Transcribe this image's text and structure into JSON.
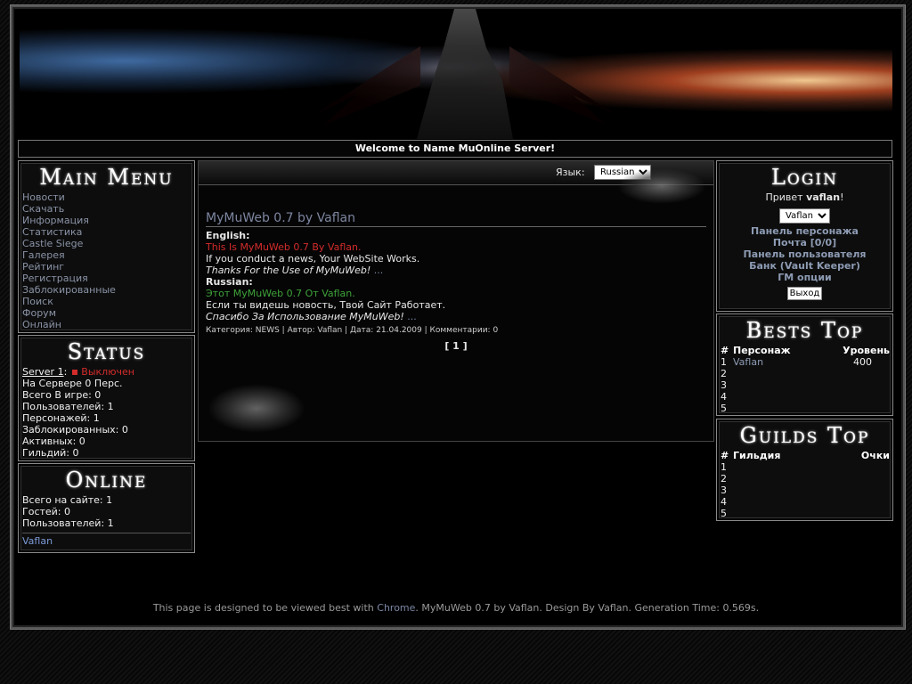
{
  "header": {
    "welcome": "Welcome to Name MuOnline Server!"
  },
  "main_menu": {
    "title": "Main Menu",
    "items": [
      "Новости",
      "Скачать",
      "Информация",
      "Статистика",
      "Castle Siege",
      "Галерея",
      "Рейтинг",
      "Регистрация",
      "Заблокированные",
      "Поиск",
      "Форум",
      "Онлайн"
    ]
  },
  "status": {
    "title": "Status",
    "server_label": "Server 1",
    "server_state": "Выключен",
    "lines": [
      "На Сервере 0 Перс.",
      "Всего В игре: 0",
      "Пользователей: 1",
      "Персонажей: 1",
      "Заблокированных: 0",
      "Активных: 0",
      "Гильдий: 0"
    ]
  },
  "online": {
    "title": "Online",
    "lines": [
      "Всего на сайте: 1",
      "Гостей: 0",
      "Пользователей: 1"
    ],
    "user": "Vaflan"
  },
  "language": {
    "label": "Язык:",
    "selected": "Russian"
  },
  "news": {
    "title": "MyMuWeb 0.7 by Vaflan",
    "english_label": "English:",
    "en_line1": "This Is MyMuWeb 0.7 By Vaflan.",
    "en_line2": "If you conduct a news, Your WebSite Works.",
    "en_line3": "Thanks For the Use of MyMuWeb!",
    "en_ellipsis": "...",
    "russian_label": "Russian:",
    "ru_line1": "Этот MyMuWeb 0.7 От Vaflan.",
    "ru_line2": "Если ты видешь новость, Твой Сайт Работает.",
    "ru_line3": "Спасибо За Использование MyMuWeb!",
    "ru_ellipsis": "...",
    "meta": "Категория: NEWS | Автор: Vaflan | Дата: 21.04.2009 | Комментарии: 0",
    "pager": "[ 1 ]"
  },
  "login": {
    "title": "Login",
    "greeting_prefix": "Привет ",
    "username": "vaflan",
    "greeting_suffix": "!",
    "char_select": "Vaflan",
    "links": [
      "Панель персонажа",
      "Почта [0/0]",
      "Панель пользователя",
      "Банк (Vault Keeper)",
      "ГМ опции"
    ],
    "logout": "Выход"
  },
  "bests_top": {
    "title": "Bests Top",
    "headers": [
      "#",
      "Персонаж",
      "Уровень"
    ],
    "rows": [
      [
        "1",
        "Vaflan",
        "400"
      ],
      [
        "2",
        "",
        ""
      ],
      [
        "3",
        "",
        ""
      ],
      [
        "4",
        "",
        ""
      ],
      [
        "5",
        "",
        ""
      ]
    ]
  },
  "guilds_top": {
    "title": "Guilds Top",
    "headers": [
      "#",
      "Гильдия",
      "Очки"
    ],
    "rows": [
      [
        "1",
        "",
        ""
      ],
      [
        "2",
        "",
        ""
      ],
      [
        "3",
        "",
        ""
      ],
      [
        "4",
        "",
        ""
      ],
      [
        "5",
        "",
        ""
      ]
    ]
  },
  "footer": {
    "prefix": "This page is designed to be viewed best with ",
    "link": "Chrome",
    "suffix": ". MyMuWeb 0.7 by Vaflan. Design By Vaflan. Generation Time: 0.569s."
  }
}
